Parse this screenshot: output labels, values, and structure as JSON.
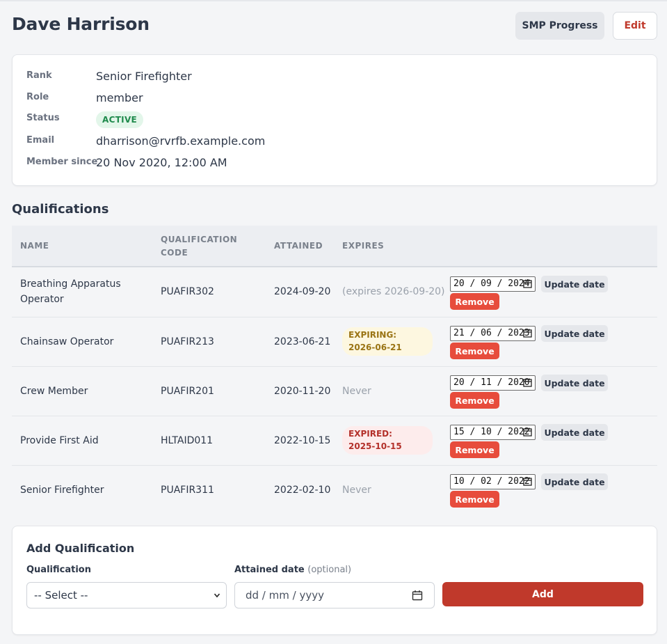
{
  "header": {
    "title": "Dave Harrison",
    "smp_label": "SMP Progress",
    "edit_label": "Edit"
  },
  "profile": {
    "rank_label": "Rank",
    "rank": "Senior Firefighter",
    "role_label": "Role",
    "role": "member",
    "status_label": "Status",
    "status": "ACTIVE",
    "email_label": "Email",
    "email": "dharrison@rvrfb.example.com",
    "since_label": "Member since",
    "since": "20 Nov 2020, 12:00 AM"
  },
  "qualifications": {
    "title": "Qualifications",
    "columns": {
      "name": "NAME",
      "code_line1": "QUALIFICATION",
      "code_line2": "CODE",
      "attained": "ATTAINED",
      "expires": "EXPIRES"
    },
    "update_label": "Update date",
    "remove_label": "Remove",
    "rows": [
      {
        "name": "Breathing Apparatus Operator",
        "code": "PUAFIR302",
        "attained": "2024-09-20",
        "expires": "(expires 2026-09-20)",
        "expires_line2": "",
        "expires_kind": "text",
        "date_value": "20 / 09 / 2024"
      },
      {
        "name": "Chainsaw Operator",
        "code": "PUAFIR213",
        "attained": "2023-06-21",
        "expires": "EXPIRING:",
        "expires_line2": "2026-06-21",
        "expires_kind": "expiring",
        "date_value": "21 / 06 / 2023"
      },
      {
        "name": "Crew Member",
        "code": "PUAFIR201",
        "attained": "2020-11-20",
        "expires": "Never",
        "expires_line2": "",
        "expires_kind": "text",
        "date_value": "20 / 11 / 2020"
      },
      {
        "name": "Provide First Aid",
        "code": "HLTAID011",
        "attained": "2022-10-15",
        "expires": "EXPIRED:",
        "expires_line2": "2025-10-15",
        "expires_kind": "expired",
        "date_value": "15 / 10 / 2022"
      },
      {
        "name": "Senior Firefighter",
        "code": "PUAFIR311",
        "attained": "2022-02-10",
        "expires": "Never",
        "expires_line2": "",
        "expires_kind": "text",
        "date_value": "10 / 02 / 2022"
      }
    ]
  },
  "add_form": {
    "title": "Add Qualification",
    "qualification_label": "Qualification",
    "select_value": "-- Select --",
    "date_label": "Attained date",
    "date_optional": "(optional)",
    "date_placeholder": "dd / mm / yyyy",
    "add_label": "Add"
  },
  "colors": {
    "accent_red": "#c0392b",
    "remove_red": "#e74c3c",
    "active_green": "#1f8a4c",
    "expiring_amber": "#9a7414"
  }
}
